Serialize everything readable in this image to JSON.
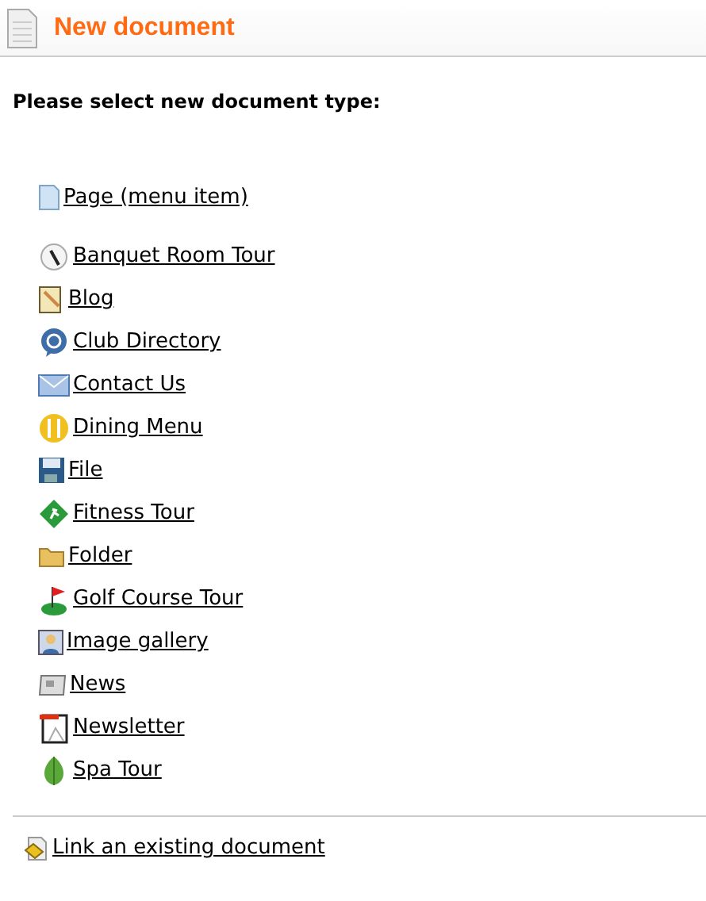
{
  "header": {
    "title": "New document"
  },
  "prompt": "Please select new document type:",
  "page_item": {
    "label": "Page (menu item)",
    "kind": "page"
  },
  "document_types": [
    {
      "label": "Banquet Room Tour",
      "kind": "tour-clock"
    },
    {
      "label": "Blog",
      "kind": "blog"
    },
    {
      "label": "Club Directory",
      "kind": "directory"
    },
    {
      "label": "Contact Us",
      "kind": "contact"
    },
    {
      "label": "Dining Menu",
      "kind": "dining"
    },
    {
      "label": "File",
      "kind": "file"
    },
    {
      "label": "Fitness Tour",
      "kind": "fitness"
    },
    {
      "label": "Folder",
      "kind": "folder"
    },
    {
      "label": "Golf Course Tour",
      "kind": "golf"
    },
    {
      "label": "Image gallery",
      "kind": "gallery"
    },
    {
      "label": "News",
      "kind": "news"
    },
    {
      "label": "Newsletter",
      "kind": "newsletter"
    },
    {
      "label": "Spa Tour",
      "kind": "spa"
    }
  ],
  "footer_link": {
    "label": "Link an existing document",
    "kind": "link"
  }
}
